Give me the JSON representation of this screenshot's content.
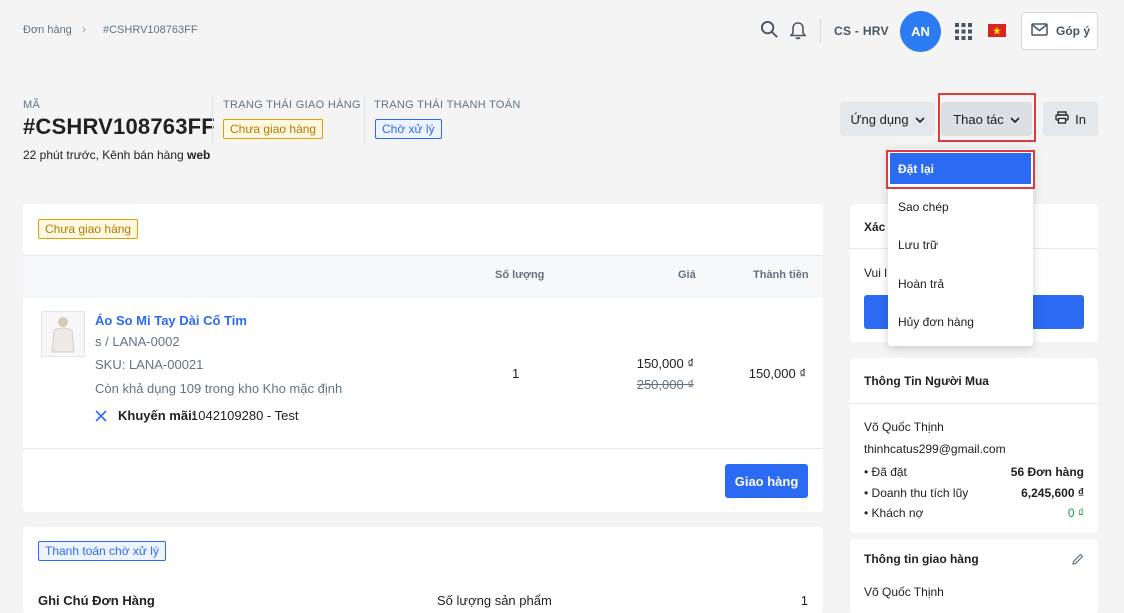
{
  "breadcrumb": {
    "root": "Đơn hàng",
    "sep": "›",
    "current": "#CSHRV108763FF"
  },
  "topbar": {
    "shop": "CS - HRV",
    "avatar": "AN",
    "feedback": "Góp ý"
  },
  "order": {
    "code_label": "MÃ",
    "code": "#CSHRV108763FF",
    "meta_prefix": "22 phút trước, Kênh bán hàng",
    "meta_channel": "web",
    "ship_status_label": "TRẠNG THÁI GIAO HÀNG",
    "ship_status": "Chưa giao hàng",
    "pay_status_label": "TRẠNG THÁI THANH TOÁN",
    "pay_status": "Chờ xử lý"
  },
  "actions": {
    "apps": "Ứng dụng",
    "actions": "Thao tác",
    "print": "In"
  },
  "dropdown": {
    "items": [
      "Đặt lại",
      "Sao chép",
      "Lưu trữ",
      "Hoàn trả",
      "Hủy đơn hàng"
    ]
  },
  "fulfillment": {
    "badge": "Chưa giao hàng",
    "headers": {
      "qty": "Số lượng",
      "price": "Giá",
      "total": "Thành tiền"
    },
    "item": {
      "name": "Áo So Mi Tay Dài Cố Tim",
      "variant": "s / LANA-0002",
      "sku": "SKU: LANA-00021",
      "stock": "Còn khả dụng 109 trong kho Kho mặc định",
      "promo_label": "Khuyến mãi:",
      "promo_value": "1042109280 - Test",
      "qty": "1",
      "price": "150,000 ₫",
      "price_old": "250,000 ₫",
      "total": "150,000 ₫"
    },
    "ship_button": "Giao hàng"
  },
  "payment": {
    "badge": "Thanh toán chờ xử lý",
    "note_label": "Ghi Chú Đơn Hàng",
    "qty_label": "Số lượng sản phẩm",
    "qty_value": "1"
  },
  "side_confirm": {
    "title_partial": "Xác",
    "body_partial": "Vui l"
  },
  "buyer": {
    "title": "Thông Tin Người Mua",
    "name": "Võ Quốc Thịnh",
    "email": "thinhcatus299@gmail.com",
    "rows": [
      {
        "label": "• Đã đặt",
        "value": "56 Đơn hàng"
      },
      {
        "label": "• Doanh thu tích lũy",
        "value": "6,245,600 ₫"
      },
      {
        "label": "• Khách nợ",
        "value": "0 ₫"
      }
    ]
  },
  "shipping_info": {
    "title": "Thông tin giao hàng",
    "name": "Võ Quốc Thịnh"
  },
  "colors": {
    "primary": "#2b6af3",
    "highlight": "#e03b3b",
    "debt_zero": "#19a34a"
  }
}
